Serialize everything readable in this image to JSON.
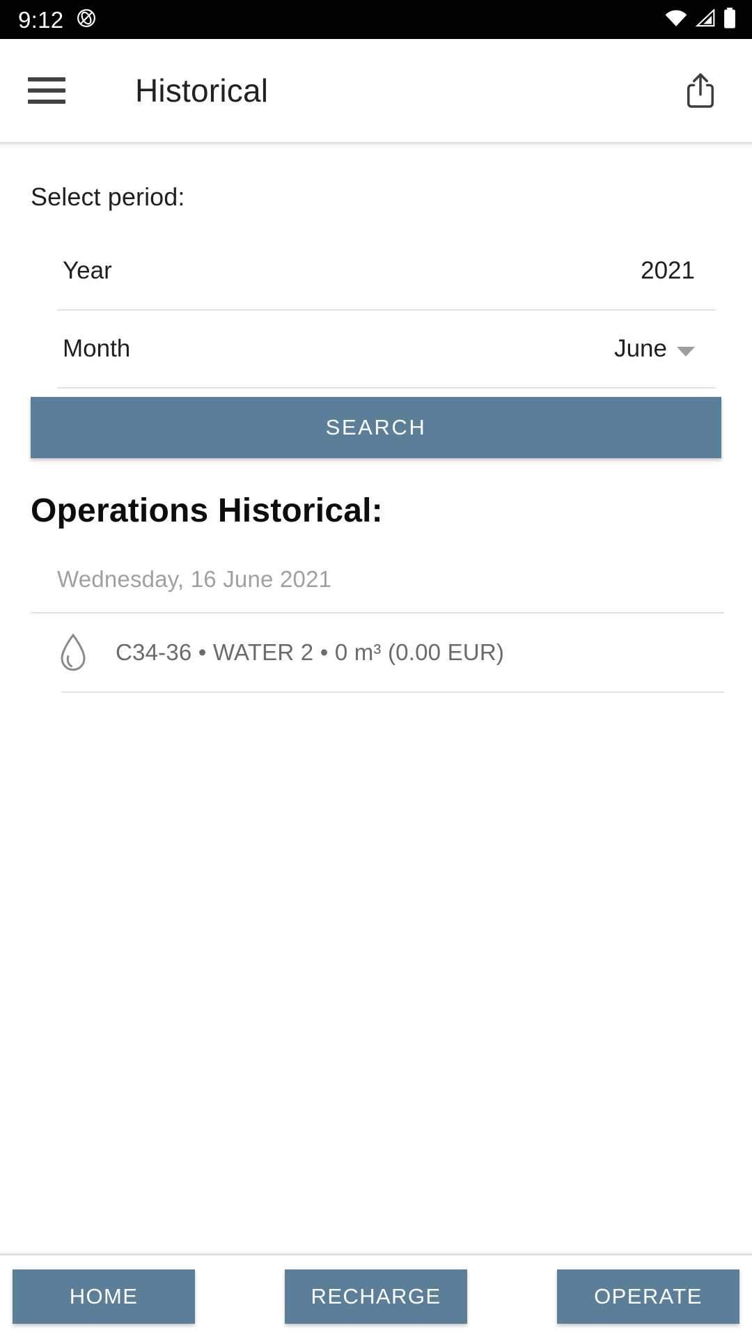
{
  "status_bar": {
    "time": "9:12",
    "icons": [
      "privacy-indicator-icon",
      "wifi-icon",
      "cellular-signal-icon",
      "battery-icon"
    ]
  },
  "app_bar": {
    "menu_icon": "hamburger-menu-icon",
    "title": "Historical",
    "share_icon": "share-icon"
  },
  "form": {
    "select_period_label": "Select period:",
    "rows": [
      {
        "label": "Year",
        "value": "2021",
        "has_caret": false
      },
      {
        "label": "Month",
        "value": "June",
        "has_caret": true
      }
    ],
    "search_label": "SEARCH"
  },
  "results": {
    "section_title": "Operations Historical:",
    "groups": [
      {
        "date": "Wednesday, 16 June 2021",
        "entries": [
          {
            "icon": "water-drop-icon",
            "text": "C34-36 • WATER 2 • 0 m³ (0.00 EUR)",
            "meter": "C34-36",
            "service": "WATER 2",
            "volume": "0 m³",
            "amount": "0.00 EUR"
          }
        ]
      }
    ]
  },
  "bottom_nav": {
    "items": [
      {
        "label": "HOME"
      },
      {
        "label": "RECHARGE"
      },
      {
        "label": "OPERATE"
      }
    ]
  },
  "colors": {
    "accent": "#5C7F99",
    "status_bar_bg": "#000000",
    "text_primary": "#1f1f1f",
    "text_muted": "#a0a0a0",
    "divider": "#e3e3e3"
  }
}
